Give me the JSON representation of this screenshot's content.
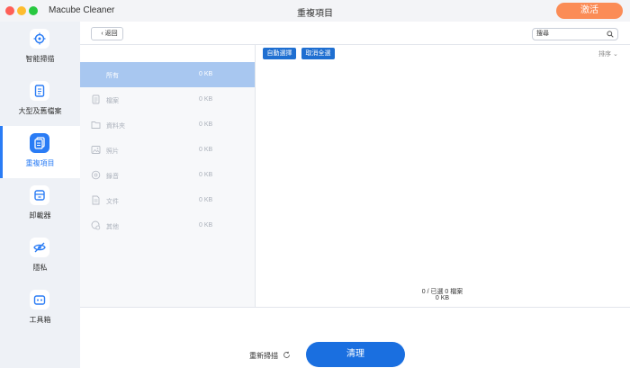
{
  "app": {
    "name": "Macube Cleaner",
    "window_title": "重複項目",
    "activate_label": "激活"
  },
  "sidebar": {
    "items": [
      {
        "label": "智能掃描",
        "icon": "scan-icon",
        "active": false
      },
      {
        "label": "大型及舊檔案",
        "icon": "large-file-icon",
        "active": false
      },
      {
        "label": "重複項目",
        "icon": "duplicate-icon",
        "active": true
      },
      {
        "label": "卸載器",
        "icon": "uninstaller-icon",
        "active": false
      },
      {
        "label": "隱私",
        "icon": "privacy-icon",
        "active": false
      },
      {
        "label": "工具箱",
        "icon": "toolbox-icon",
        "active": false
      }
    ]
  },
  "toolbar": {
    "back_label": "返回",
    "search_placeholder": "搜尋"
  },
  "actions": {
    "auto_select": "自動選擇",
    "deselect_all": "取消全選",
    "sort_label": "排序"
  },
  "categories": [
    {
      "name": "所有",
      "size": "0 KB",
      "active": true
    },
    {
      "name": "檔案",
      "size": "0 KB",
      "active": false
    },
    {
      "name": "資料夾",
      "size": "0 KB",
      "active": false
    },
    {
      "name": "照片",
      "size": "0 KB",
      "active": false
    },
    {
      "name": "錄音",
      "size": "0 KB",
      "active": false
    },
    {
      "name": "文件",
      "size": "0 KB",
      "active": false
    },
    {
      "name": "其他",
      "size": "0 KB",
      "active": false
    }
  ],
  "summary": {
    "selected_text": "0 / 已選 0 檔案",
    "size_text": "0 KB"
  },
  "footer": {
    "rescan_label": "重新掃描",
    "clean_label": "清理"
  },
  "colors": {
    "accent": "#2a7cf5",
    "activate": "#fb8c56",
    "clean": "#1a6fe0"
  }
}
